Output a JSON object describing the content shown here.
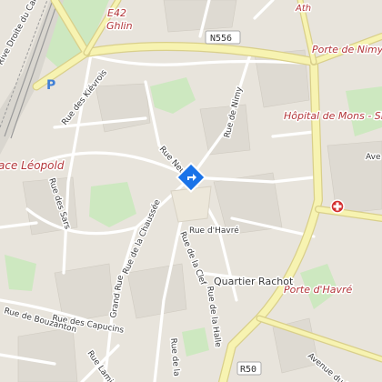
{
  "map": {
    "place_labels": [
      {
        "id": "place-leopold",
        "text": "ace Léopold"
      },
      {
        "id": "porte-de-nimy",
        "text": "Porte de Nimy"
      },
      {
        "id": "porte-havre",
        "text": "Porte d'Havré"
      },
      {
        "id": "hopital",
        "text": "Hôpital de Mons - Site"
      },
      {
        "id": "ghlin",
        "text": "Ghlin"
      },
      {
        "id": "quartier-rachot",
        "text": "Quartier Rachot"
      },
      {
        "id": "top-right",
        "text": "Ath"
      }
    ],
    "route_labels": [
      {
        "id": "e42",
        "text": "E42"
      },
      {
        "id": "n556",
        "text": "N556"
      },
      {
        "id": "r50",
        "text": "R50"
      }
    ],
    "street_labels": [
      {
        "id": "rue-kievrois",
        "text": "Rue des Kiévrois"
      },
      {
        "id": "rue-sars",
        "text": "Rue des Sars"
      },
      {
        "id": "rue-neuve",
        "text": "Rue Neuve"
      },
      {
        "id": "rue-nimy",
        "text": "Rue de Nimy"
      },
      {
        "id": "rue-havre",
        "text": "Rue d'Havré"
      },
      {
        "id": "rue-clef",
        "text": "Rue de la Clef"
      },
      {
        "id": "rue-chaussee",
        "text": "Rue de la Chaussée"
      },
      {
        "id": "grand-rue",
        "text": "Grand Rue"
      },
      {
        "id": "rue-capucins",
        "text": "Rue des Capucins"
      },
      {
        "id": "rue-bouzanton",
        "text": "Rue de Bouzanton"
      },
      {
        "id": "rue-halle",
        "text": "Rue de la Halle"
      },
      {
        "id": "rue-lamir",
        "text": "Rue Lamir"
      },
      {
        "id": "avenue-porte",
        "text": "Avenue du Port"
      },
      {
        "id": "rive-droite",
        "text": "Rive Droite du Canal"
      },
      {
        "id": "rue-partial",
        "text": "Rue de la"
      },
      {
        "id": "ave-partial",
        "text": "Ave"
      }
    ],
    "markers": [
      {
        "id": "selected-location",
        "icon": "directions-diamond-icon",
        "color": "#1a73e8"
      },
      {
        "id": "hospital",
        "icon": "hospital-cross-icon",
        "color": "#d32f2f"
      },
      {
        "id": "parking",
        "icon": "parking-icon",
        "text": "P",
        "color": "#3f7fd6"
      }
    ],
    "colors": {
      "background": "#f1efe9",
      "ring_road": "#f7f3b1",
      "ring_road_edge": "#d9cf8a",
      "park": "#cde8c0",
      "railway": "#9a9a9a",
      "label_red": "#b3363a"
    }
  }
}
